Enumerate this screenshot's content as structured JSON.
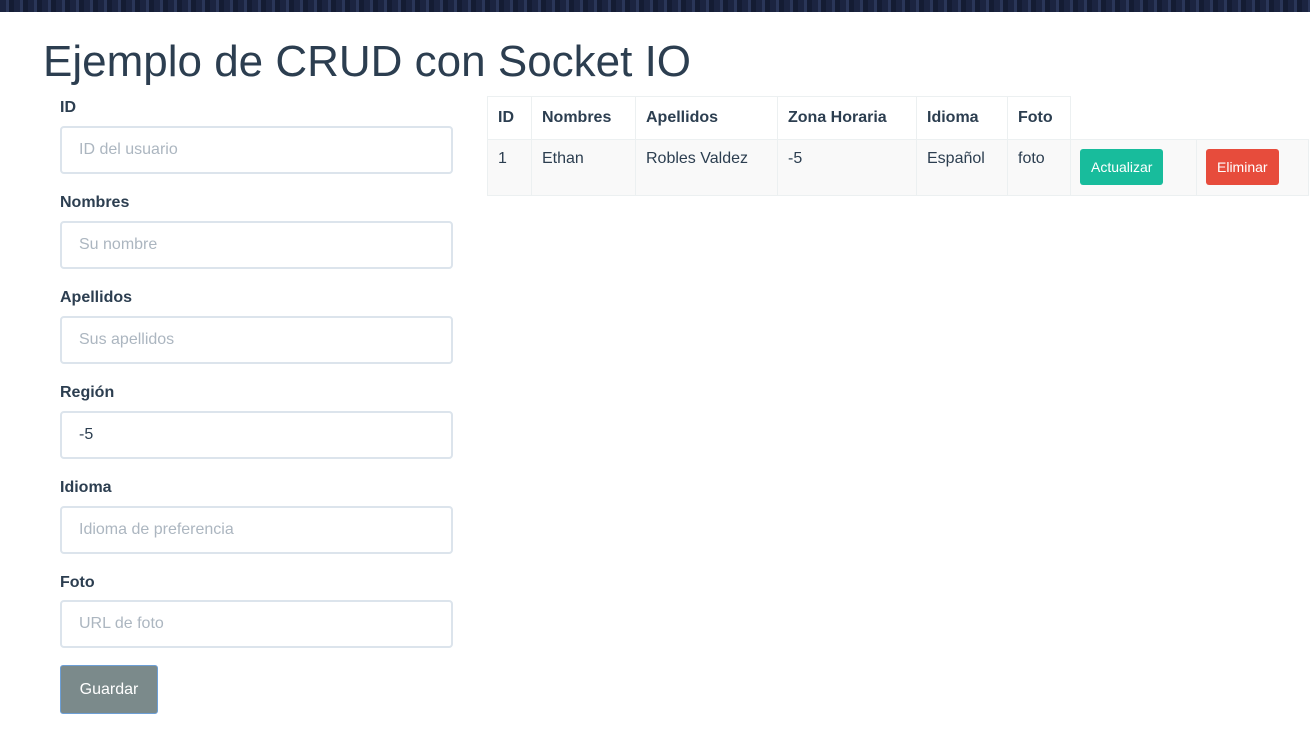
{
  "page": {
    "title": "Ejemplo de CRUD con Socket IO"
  },
  "form": {
    "fields": [
      {
        "label": "ID",
        "value": "",
        "placeholder": "ID del usuario"
      },
      {
        "label": "Nombres",
        "value": "",
        "placeholder": "Su nombre"
      },
      {
        "label": "Apellidos",
        "value": "",
        "placeholder": "Sus apellidos"
      },
      {
        "label": "Región",
        "value": "-5",
        "placeholder": ""
      },
      {
        "label": "Idioma",
        "value": "",
        "placeholder": "Idioma de preferencia"
      },
      {
        "label": "Foto",
        "value": "",
        "placeholder": "URL de foto"
      }
    ],
    "save_label": "Guardar"
  },
  "table": {
    "headers": [
      "ID",
      "Nombres",
      "Apellidos",
      "Zona Horaria",
      "Idioma",
      "Foto"
    ],
    "rows": [
      {
        "cells": [
          "1",
          "Ethan",
          "Robles Valdez",
          "-5",
          "Español",
          "foto"
        ],
        "update_label": "Actualizar",
        "delete_label": "Eliminar"
      }
    ]
  },
  "colors": {
    "text": "#2c3e50",
    "success": "#18bc9c",
    "danger": "#e74c3c",
    "secondary": "#7b8a8b"
  }
}
